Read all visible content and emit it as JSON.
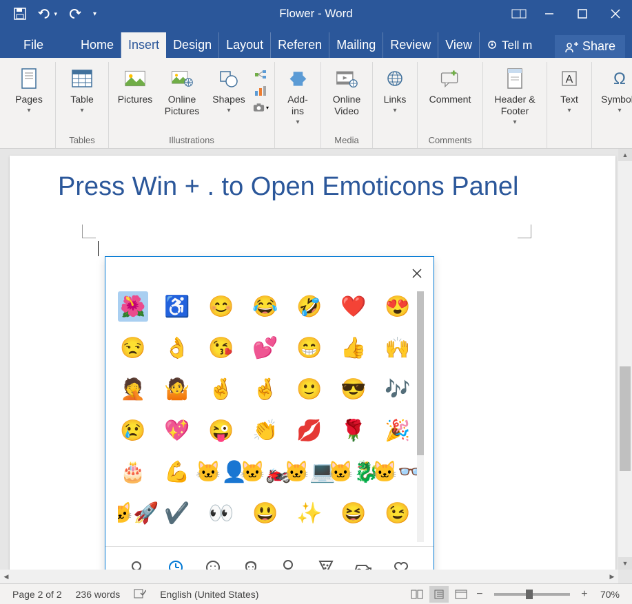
{
  "title": "Flower - Word",
  "tabs": {
    "file": "File",
    "home": "Home",
    "insert": "Insert",
    "design": "Design",
    "layout": "Layout",
    "references": "Referen",
    "mailings": "Mailing",
    "review": "Review",
    "view": "View"
  },
  "tellme": "Tell m",
  "share": "Share",
  "ribbon": {
    "pages": "Pages",
    "table": "Table",
    "pictures": "Pictures",
    "online_pictures": "Online Pictures",
    "shapes": "Shapes",
    "addins": "Add-ins",
    "online_video": "Online Video",
    "links": "Links",
    "comment": "Comment",
    "header_footer": "Header & Footer",
    "text": "Text",
    "symbols": "Symbols",
    "group_tables": "Tables",
    "group_illustrations": "Illustrations",
    "group_media": "Media",
    "group_comments": "Comments"
  },
  "document": {
    "heading": "Press Win + . to Open Emoticons Panel"
  },
  "emoji": {
    "rows": [
      [
        "🌺",
        "♿",
        "😊",
        "😂",
        "🤣",
        "❤️",
        "😍"
      ],
      [
        "😒",
        "👌",
        "😘",
        "💕",
        "😁",
        "👍",
        "🙌"
      ],
      [
        "🤦",
        "🤷",
        "🤞",
        "🤞",
        "🙂",
        "😎",
        "🎶"
      ],
      [
        "😢",
        "💖",
        "😜",
        "👏",
        "💋",
        "🌹",
        "🎉"
      ],
      [
        "🎂",
        "💪",
        "🐱‍👤",
        "🐱‍🏍",
        "🐱‍💻",
        "🐱‍🐉",
        "🐱‍👓"
      ],
      [
        "🐱‍🚀",
        "✔️",
        "👀",
        "😃",
        "✨",
        "😆",
        "😉"
      ]
    ],
    "categories": [
      "search",
      "recent",
      "smileys",
      "people",
      "balloon",
      "food",
      "car",
      "heart"
    ]
  },
  "status": {
    "page": "Page 2 of 2",
    "words": "236 words",
    "language": "English (United States)",
    "zoom": "70%"
  }
}
